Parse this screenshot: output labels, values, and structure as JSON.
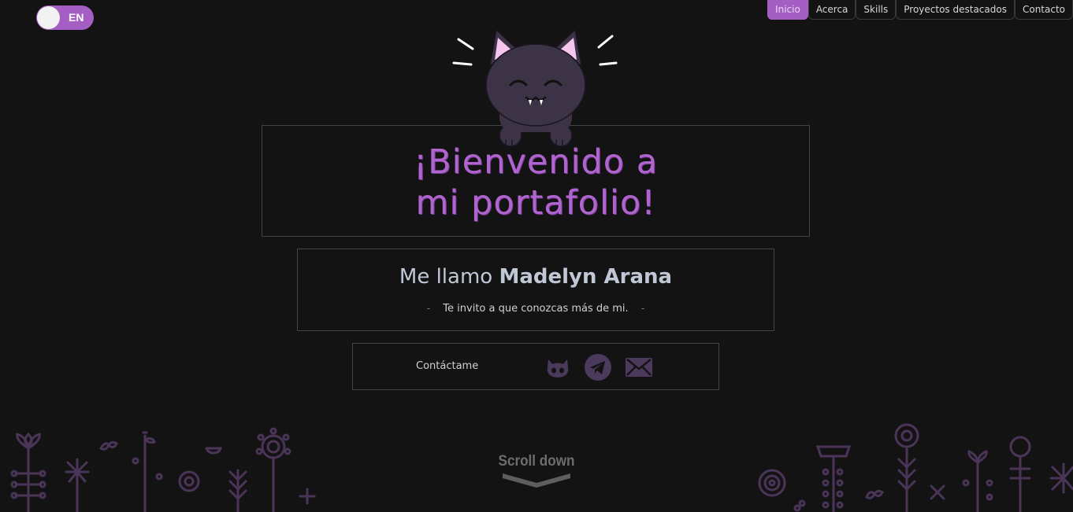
{
  "language_toggle": {
    "label": "EN"
  },
  "nav": {
    "items": [
      {
        "label": "Inicio",
        "active": true
      },
      {
        "label": "Acerca",
        "active": false
      },
      {
        "label": "Skills",
        "active": false
      },
      {
        "label": "Proyectos destacados",
        "active": false
      },
      {
        "label": "Contacto",
        "active": false
      }
    ]
  },
  "hero": {
    "title_line1": "¡Bienvenido a",
    "title_line2": "mi portafolio!",
    "intro_prefix": "Me llamo",
    "intro_name": "Madelyn Arana",
    "subtitle": "Te invito a que conozcas más de mi.",
    "subtitle_dash": "-"
  },
  "contact": {
    "label": "Contáctame",
    "icons": [
      "github-icon",
      "telegram-icon",
      "mail-icon"
    ]
  },
  "scroll": {
    "label": "Scroll down"
  },
  "colors": {
    "background": "#141314",
    "accent": "#a55fc4",
    "title": "#b064d0",
    "icon": "#4b3a5c",
    "plants": "#4a3458"
  }
}
